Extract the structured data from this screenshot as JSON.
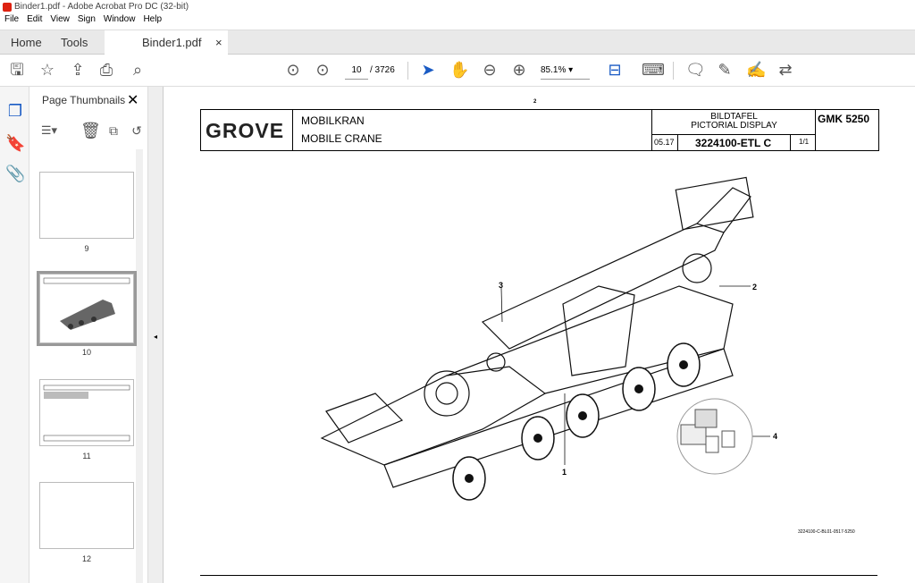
{
  "window": {
    "title": "Binder1.pdf - Adobe Acrobat Pro DC (32-bit)"
  },
  "menu": [
    "File",
    "Edit",
    "View",
    "Sign",
    "Window",
    "Help"
  ],
  "tabs": {
    "home": "Home",
    "tools": "Tools",
    "doc": "Binder1.pdf",
    "close": "×"
  },
  "toolbar": {
    "page": "10",
    "total": "/ 3726",
    "zoom": "85.1%"
  },
  "panel": {
    "title": "Page Thumbnails",
    "close": "✕",
    "thumbs": [
      "9",
      "10",
      "11",
      "12"
    ]
  },
  "doc": {
    "page_number": "2",
    "logo": "GROVE",
    "title_de": "MOBILKRAN",
    "title_en": "MOBILE CRANE",
    "bild_de": "BILDTAFEL",
    "bild_en": "PICTORIAL DISPLAY",
    "date": "05.17",
    "code": "3224100-ETL C",
    "of": "1/1",
    "model": "GMK 5250",
    "callouts": [
      "1",
      "2",
      "3",
      "4"
    ],
    "ref": "3224100-C-BL01-0517-5250"
  }
}
